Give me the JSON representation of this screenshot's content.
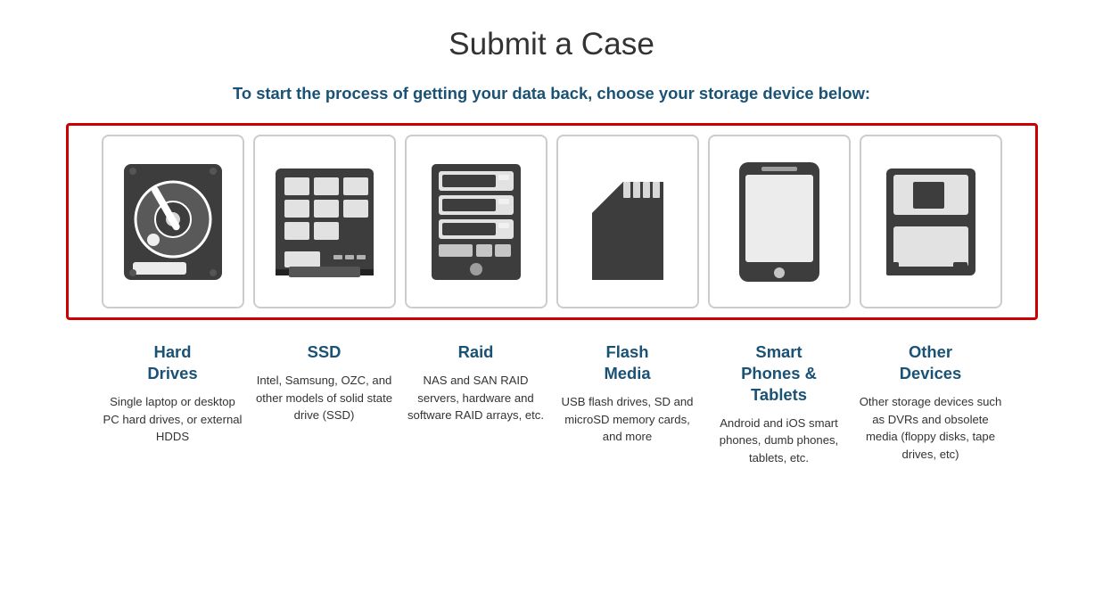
{
  "page": {
    "title": "Submit a Case",
    "subtitle": "To start the process of getting your data back, choose your storage device below:"
  },
  "devices": [
    {
      "id": "hard-drives",
      "label": "Hard\nDrives",
      "description": "Single laptop or desktop PC hard drives, or external HDDS"
    },
    {
      "id": "ssd",
      "label": "SSD",
      "description": "Intel, Samsung, OZC, and other models of solid state drive (SSD)"
    },
    {
      "id": "raid",
      "label": "Raid",
      "description": "NAS and SAN RAID servers, hardware and software RAID arrays, etc."
    },
    {
      "id": "flash-media",
      "label": "Flash\nMedia",
      "description": "USB flash drives, SD and microSD memory cards, and more"
    },
    {
      "id": "smart-phones",
      "label": "Smart\nPhones &\nTablets",
      "description": "Android and iOS smart phones, dumb phones, tablets, etc."
    },
    {
      "id": "other-devices",
      "label": "Other\nDevices",
      "description": "Other storage devices such as DVRs and obsolete media (floppy disks, tape drives, etc)"
    }
  ]
}
